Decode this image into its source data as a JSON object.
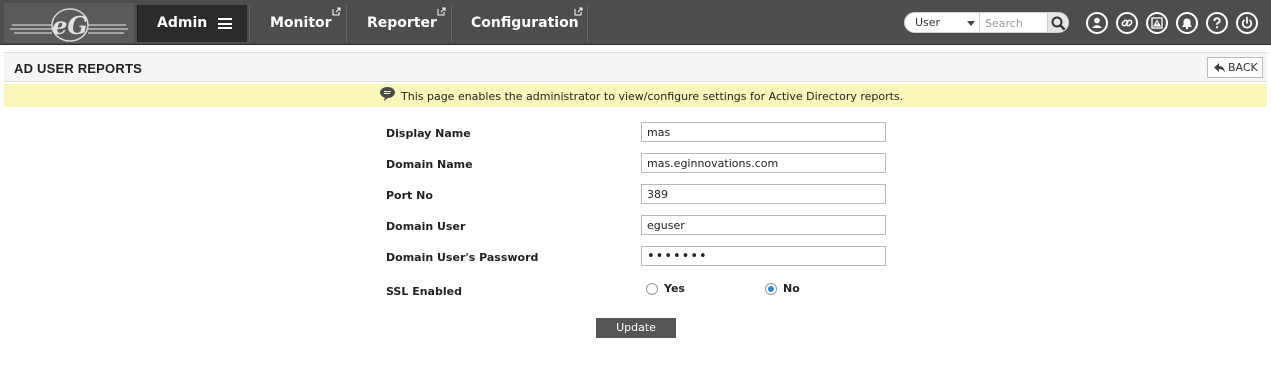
{
  "logo": {
    "text": "eG"
  },
  "nav": {
    "admin": "Admin",
    "monitor": "Monitor",
    "reporter": "Reporter",
    "configuration": "Configuration"
  },
  "search": {
    "scope": "User",
    "placeholder": "Search"
  },
  "toolbar_icons": [
    "user-icon",
    "link-icon",
    "alert-icon",
    "bell-icon",
    "help-icon",
    "power-icon"
  ],
  "page": {
    "title": "AD USER REPORTS",
    "back_label": "BACK",
    "info": "This page enables the administrator to view/configure settings for Active Directory reports."
  },
  "form": {
    "display_name": {
      "label": "Display Name",
      "value": "mas"
    },
    "domain_name": {
      "label": "Domain Name",
      "value": "mas.eginnovations.com"
    },
    "port_no": {
      "label": "Port No",
      "value": "389"
    },
    "domain_user": {
      "label": "Domain User",
      "value": "eguser"
    },
    "domain_password": {
      "label": "Domain User's Password",
      "value": "•••••••"
    },
    "ssl": {
      "label": "SSL Enabled",
      "yes": "Yes",
      "no": "No",
      "selected": "No"
    },
    "update_label": "Update"
  },
  "colors": {
    "topbar": "#4d4d4d",
    "active_tab": "#2b2b2b",
    "info_bar": "#fbf6b9",
    "radio_selected": "#2d8ad8",
    "update_button": "#555555"
  }
}
